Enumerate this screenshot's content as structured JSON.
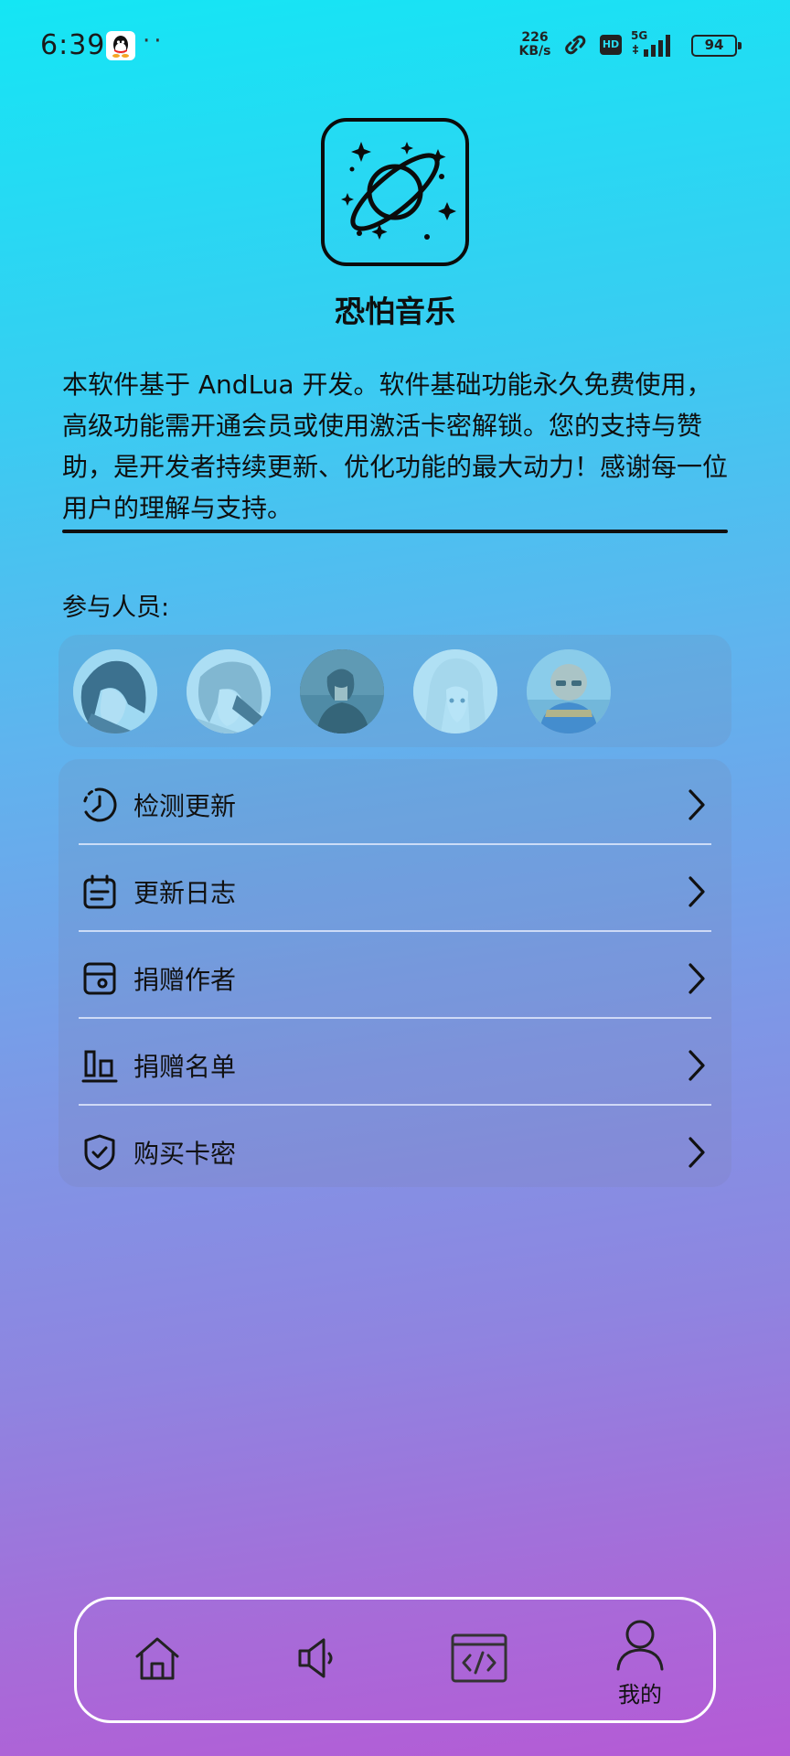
{
  "status_bar": {
    "time": "6:39",
    "dots": "··",
    "net_speed_value": "226",
    "net_speed_unit": "KB/s",
    "hd": "HD",
    "network": "5G",
    "battery": "94"
  },
  "header": {
    "app_icon": "planet-icon",
    "app_name": "恐怕音乐"
  },
  "intro": "本软件基于 AndLua 开发。软件基础功能永久免费使用，高级功能需开通会员或使用激活卡密解锁。您的支持与赞助，是开发者持续更新、优化功能的最大动力！感谢每一位用户的理解与支持。",
  "contributors": {
    "title": "参与人员:",
    "avatars": [
      {
        "icon": "anime-boy-avatar"
      },
      {
        "icon": "anime-boy-sketch-avatar"
      },
      {
        "icon": "dark-figure-avatar"
      },
      {
        "icon": "anime-girl-avatar"
      },
      {
        "icon": "bald-man-photo-avatar"
      }
    ]
  },
  "menu": [
    {
      "label": "检测更新",
      "icon": "clock-icon"
    },
    {
      "label": "更新日志",
      "icon": "calendar-icon"
    },
    {
      "label": "捐赠作者",
      "icon": "wallet-icon"
    },
    {
      "label": "捐赠名单",
      "icon": "bar-chart-icon"
    },
    {
      "label": "购买卡密",
      "icon": "shield-check-icon"
    }
  ],
  "bottom_nav": [
    {
      "icon": "home-icon",
      "label": ""
    },
    {
      "icon": "speaker-icon",
      "label": ""
    },
    {
      "icon": "code-icon",
      "label": ""
    },
    {
      "icon": "user-icon",
      "label": "我的",
      "active": true
    }
  ]
}
